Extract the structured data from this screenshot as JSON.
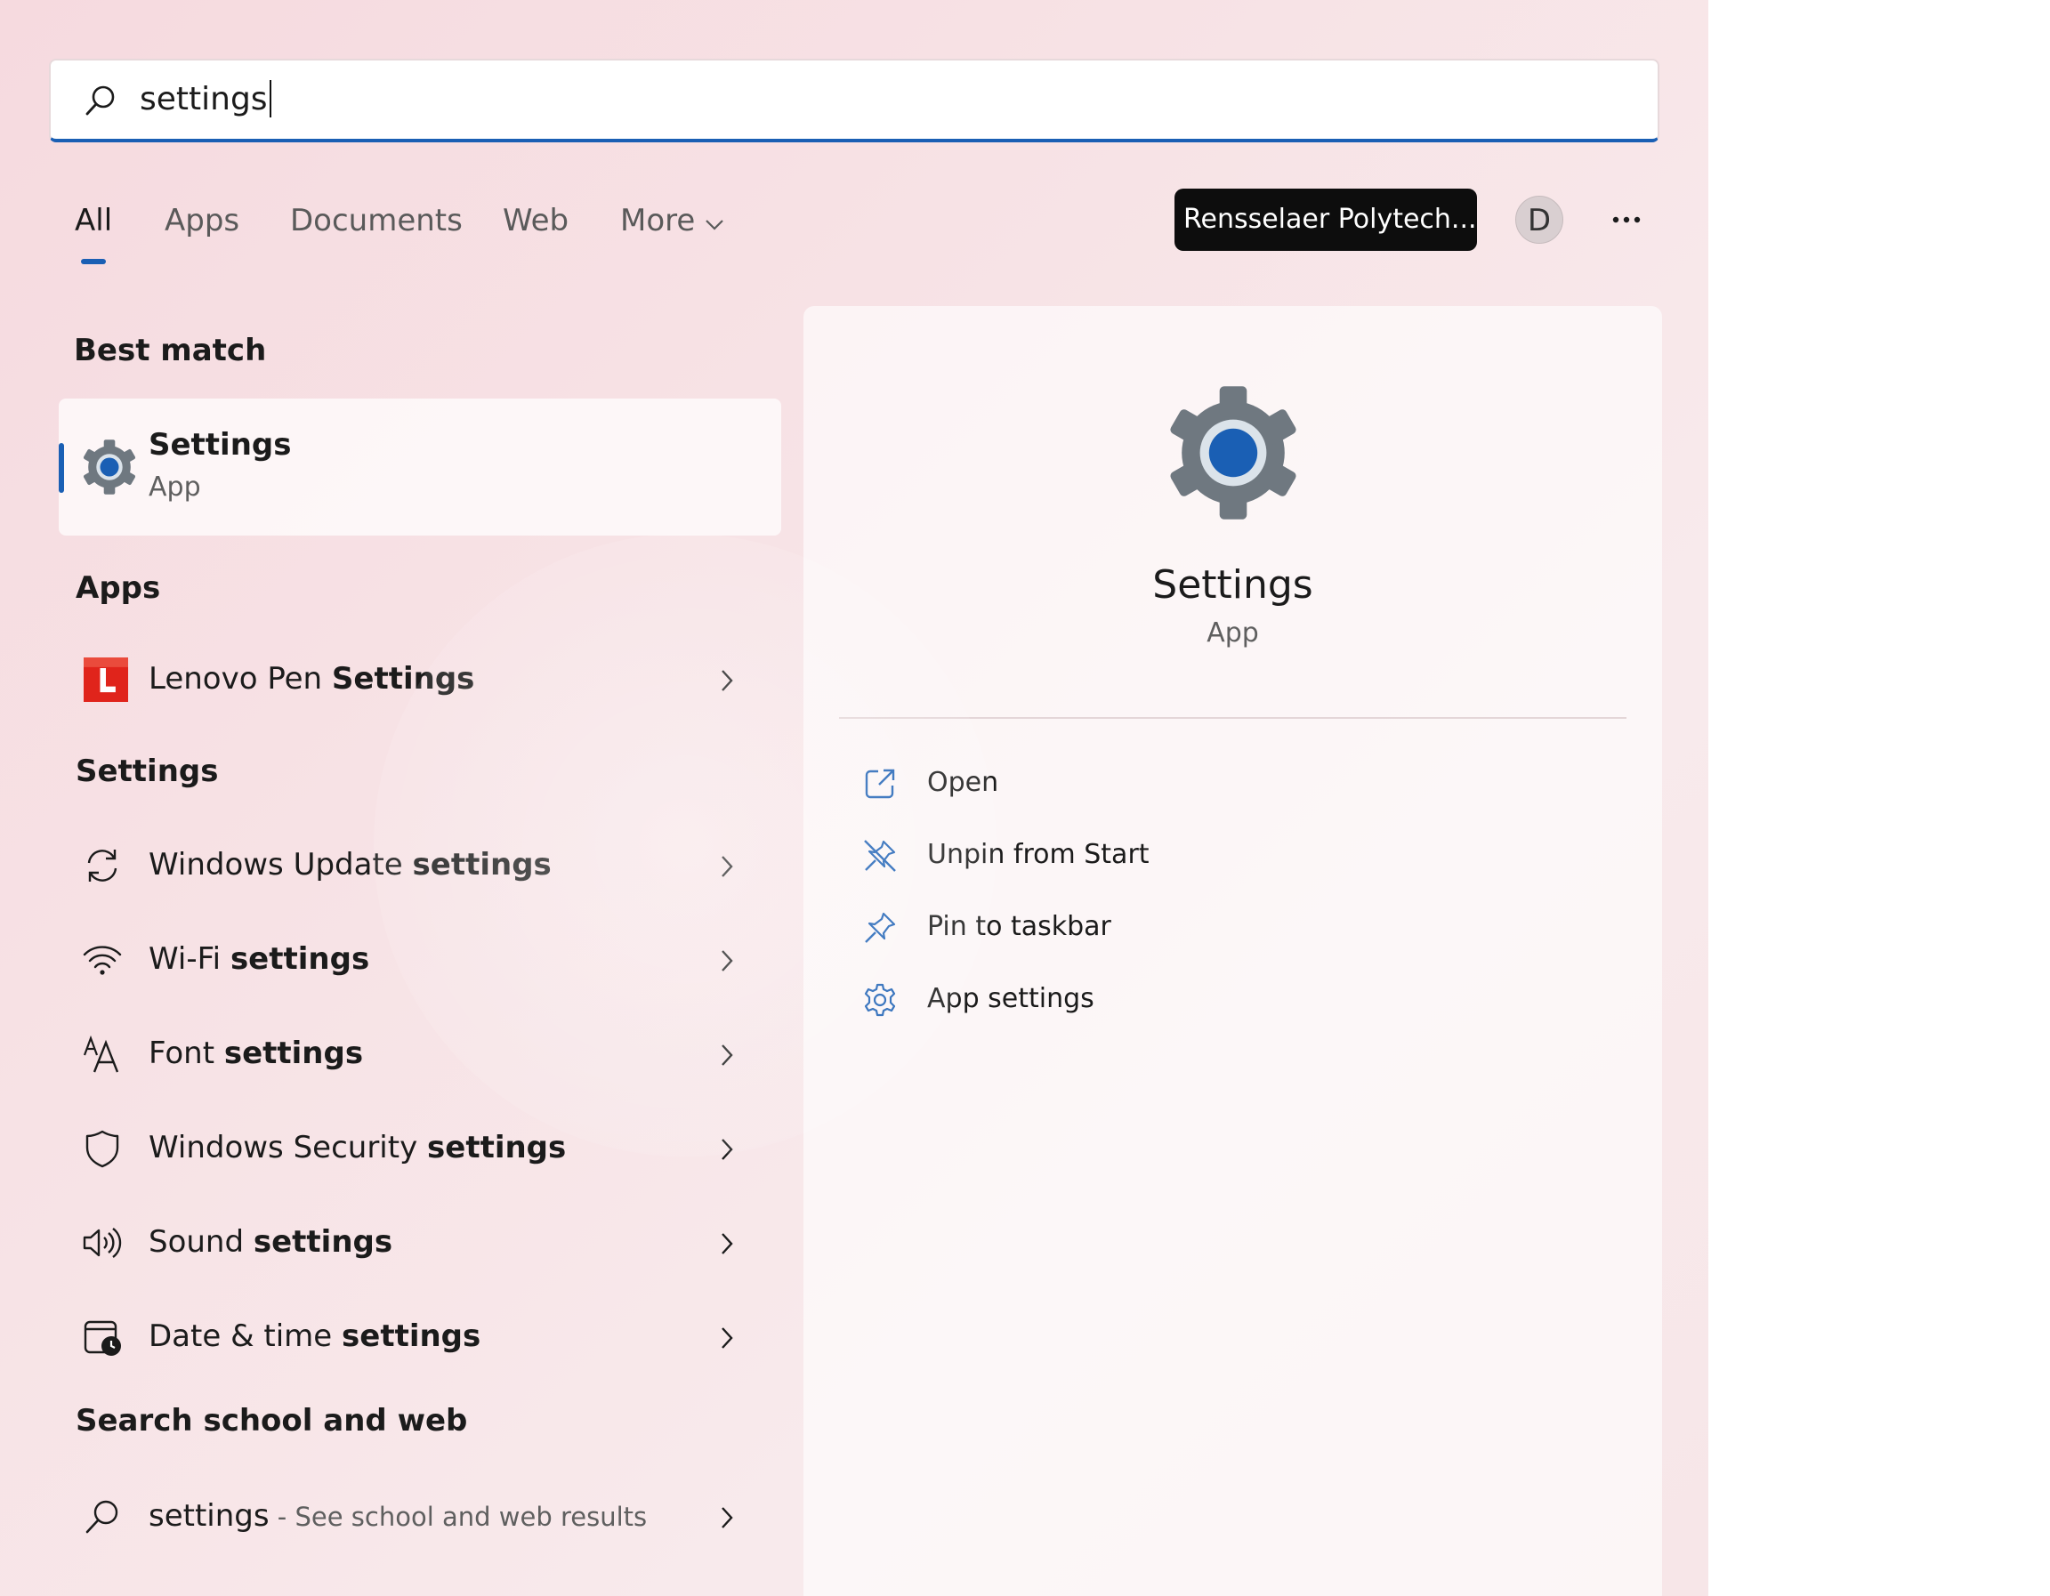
{
  "search": {
    "value": "settings"
  },
  "filters": {
    "tabs": [
      "All",
      "Apps",
      "Documents",
      "Web",
      "More"
    ]
  },
  "header": {
    "org_label": "Rensselaer Polytech...",
    "avatar_letter": "D"
  },
  "sections": {
    "best_match": "Best match",
    "apps": "Apps",
    "settings": "Settings",
    "web": "Search school and web"
  },
  "best_match": {
    "name": "Settings",
    "type": "App",
    "icon": "settings-gear-icon"
  },
  "apps": [
    {
      "prefix": "Lenovo Pen ",
      "match": "Settings",
      "suffix": "",
      "icon": "lenovo-pen-icon"
    }
  ],
  "settings_results": [
    {
      "prefix": "Windows Update ",
      "match": "settings",
      "icon": "refresh-icon"
    },
    {
      "prefix": "Wi-Fi ",
      "match": "settings",
      "icon": "wifi-icon"
    },
    {
      "prefix": "Font ",
      "match": "settings",
      "icon": "font-icon"
    },
    {
      "prefix": "Windows Security ",
      "match": "settings",
      "icon": "shield-icon"
    },
    {
      "prefix": "Sound ",
      "match": "settings",
      "icon": "speaker-icon"
    },
    {
      "prefix": "Date & time ",
      "match": "settings",
      "icon": "calendar-clock-icon"
    }
  ],
  "web_result": {
    "query": "settings",
    "hint": " - See school and web results",
    "icon": "search-icon"
  },
  "preview": {
    "name": "Settings",
    "type": "App",
    "actions": [
      {
        "label": "Open",
        "icon": "open-external-icon"
      },
      {
        "label": "Unpin from Start",
        "icon": "unpin-icon"
      },
      {
        "label": "Pin to taskbar",
        "icon": "pin-icon"
      },
      {
        "label": "App settings",
        "icon": "gear-icon"
      }
    ]
  },
  "colors": {
    "accent": "#1a5fb4",
    "panel_bg": "#f7e2e5",
    "lenovo_red": "#e0241b"
  }
}
